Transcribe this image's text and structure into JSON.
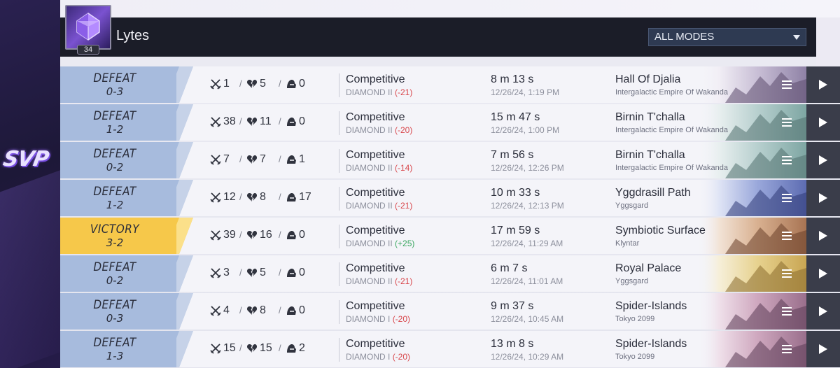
{
  "player": {
    "name": "Lytes",
    "level": "34"
  },
  "svp": "SVP",
  "mode_filter": {
    "selected": "ALL MODES"
  },
  "matches": [
    {
      "result": "DEFEAT",
      "score": "0-3",
      "kills": "1",
      "deaths": "5",
      "assists": "0",
      "mode": "Competitive",
      "rank": "DIAMOND II",
      "delta": "(-21)",
      "delta_sign": "neg",
      "duration": "8 m 13 s",
      "datetime": "12/26/24, 1:19 PM",
      "map": "Hall Of Djalia",
      "region": "Intergalactic Empire Of Wakanda",
      "map_theme": "wakanda-hall"
    },
    {
      "result": "DEFEAT",
      "score": "1-2",
      "kills": "38",
      "deaths": "11",
      "assists": "0",
      "mode": "Competitive",
      "rank": "DIAMOND II",
      "delta": "(-20)",
      "delta_sign": "neg",
      "duration": "15 m 47 s",
      "datetime": "12/26/24, 1:00 PM",
      "map": "Birnin T'challa",
      "region": "Intergalactic Empire Of Wakanda",
      "map_theme": "wakanda-city"
    },
    {
      "result": "DEFEAT",
      "score": "0-2",
      "kills": "7",
      "deaths": "7",
      "assists": "1",
      "mode": "Competitive",
      "rank": "DIAMOND II",
      "delta": "(-14)",
      "delta_sign": "neg",
      "duration": "7 m 56 s",
      "datetime": "12/26/24, 12:26 PM",
      "map": "Birnin T'challa",
      "region": "Intergalactic Empire Of Wakanda",
      "map_theme": "wakanda-city"
    },
    {
      "result": "DEFEAT",
      "score": "1-2",
      "kills": "12",
      "deaths": "8",
      "assists": "17",
      "mode": "Competitive",
      "rank": "DIAMOND II",
      "delta": "(-21)",
      "delta_sign": "neg",
      "duration": "10 m 33 s",
      "datetime": "12/26/24, 12:13 PM",
      "map": "Yggdrasill Path",
      "region": "Yggsgard",
      "map_theme": "yggdrasill"
    },
    {
      "result": "VICTORY",
      "score": "3-2",
      "kills": "39",
      "deaths": "16",
      "assists": "0",
      "mode": "Competitive",
      "rank": "DIAMOND II",
      "delta": "(+25)",
      "delta_sign": "pos",
      "duration": "17 m 59 s",
      "datetime": "12/26/24, 11:29 AM",
      "map": "Symbiotic Surface",
      "region": "Klyntar",
      "map_theme": "klyntar"
    },
    {
      "result": "DEFEAT",
      "score": "0-2",
      "kills": "3",
      "deaths": "5",
      "assists": "0",
      "mode": "Competitive",
      "rank": "DIAMOND II",
      "delta": "(-21)",
      "delta_sign": "neg",
      "duration": "6 m 7 s",
      "datetime": "12/26/24, 11:01 AM",
      "map": "Royal Palace",
      "region": "Yggsgard",
      "map_theme": "palace"
    },
    {
      "result": "DEFEAT",
      "score": "0-3",
      "kills": "4",
      "deaths": "8",
      "assists": "0",
      "mode": "Competitive",
      "rank": "DIAMOND I",
      "delta": "(-20)",
      "delta_sign": "neg",
      "duration": "9 m 37 s",
      "datetime": "12/26/24, 10:45 AM",
      "map": "Spider-Islands",
      "region": "Tokyo 2099",
      "map_theme": "tokyo"
    },
    {
      "result": "DEFEAT",
      "score": "1-3",
      "kills": "15",
      "deaths": "15",
      "assists": "2",
      "mode": "Competitive",
      "rank": "DIAMOND I",
      "delta": "(-20)",
      "delta_sign": "neg",
      "duration": "13 m 8 s",
      "datetime": "12/26/24, 10:29 AM",
      "map": "Spider-Islands",
      "region": "Tokyo 2099",
      "map_theme": "tokyo"
    }
  ],
  "icons": {
    "kills": "crossed-swords-icon",
    "deaths": "broken-heart-icon",
    "assists": "helmet-assist-icon",
    "detail": "list-icon",
    "replay": "play-icon"
  },
  "colors": {
    "victory": "#f6c84a",
    "defeat": "#a7bbdd",
    "negative": "#d8474c",
    "positive": "#3aa760",
    "header": "#1b1d28"
  }
}
